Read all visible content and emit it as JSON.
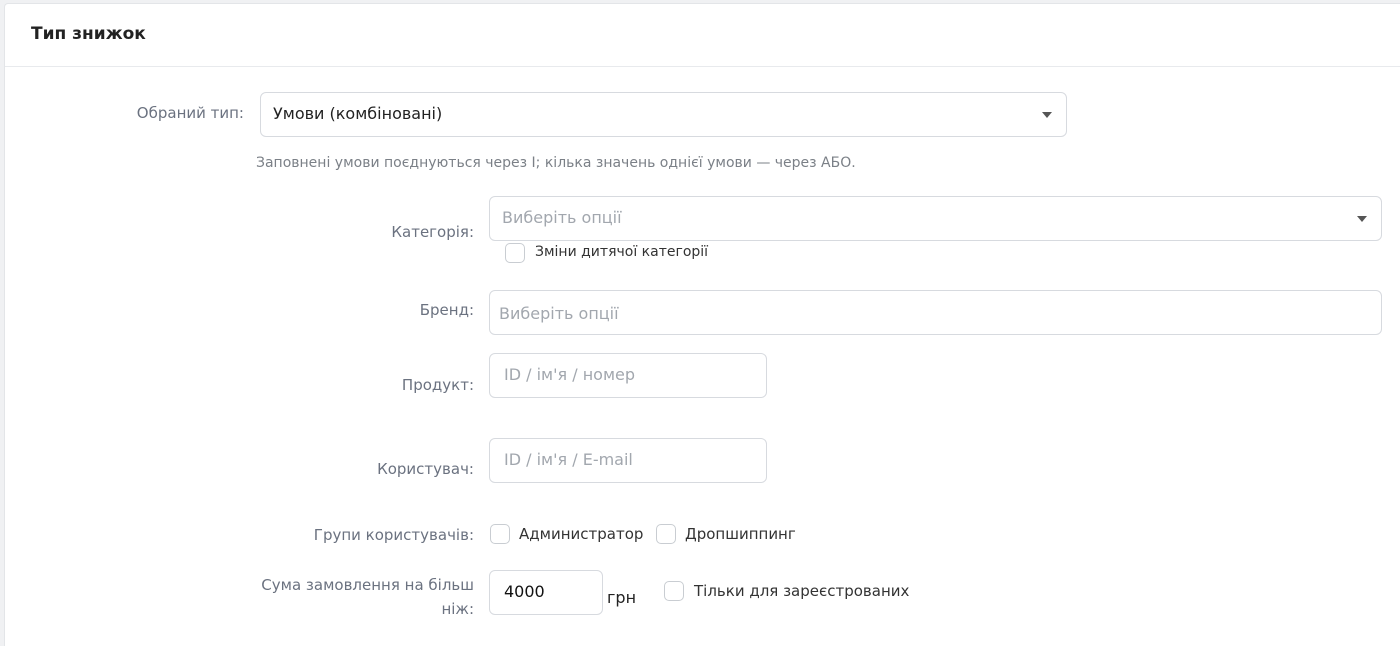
{
  "section": {
    "title": "Тип знижок"
  },
  "type_select": {
    "label": "Обраний тип:",
    "value": "Умови (комбіновані)"
  },
  "hint": "Заповнені умови поєднуються через І; кілька значень однієї умови — через АБО.",
  "category": {
    "label": "Категорія:",
    "placeholder": "Виберіть опції",
    "child_checkbox_label": "Зміни дитячої категорії"
  },
  "brand": {
    "label": "Бренд:",
    "placeholder": "Виберіть опції"
  },
  "product": {
    "label": "Продукт:",
    "placeholder": "ID / ім'я / номер"
  },
  "user": {
    "label": "Користувач:",
    "placeholder": "ID / ім'я / E-mail"
  },
  "user_groups": {
    "label": "Групи користувачів:",
    "options": [
      "Администратор",
      "Дропшиппинг"
    ]
  },
  "order_sum": {
    "label_line1": "Сума замовлення на більш",
    "label_line2": "ніж:",
    "value": "4000",
    "unit": "грн",
    "registered_only_label": "Тільки для зареєстрованих"
  }
}
